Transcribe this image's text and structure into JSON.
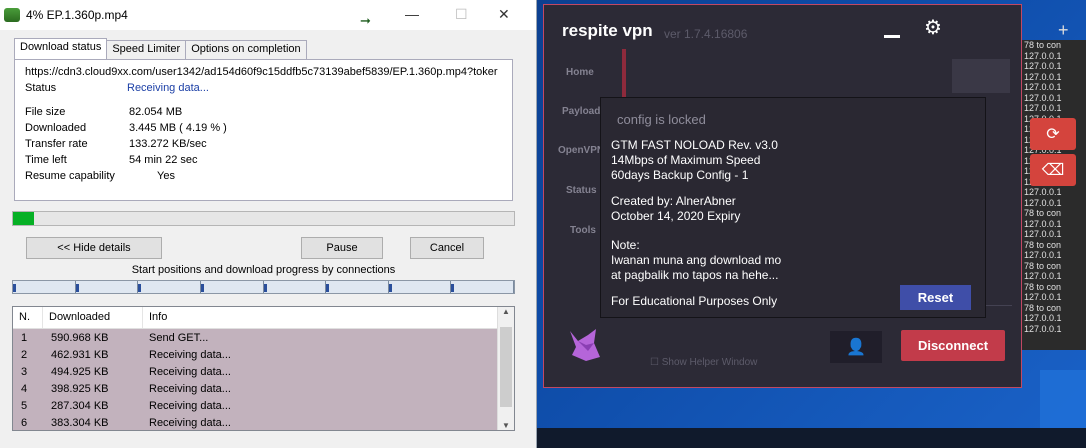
{
  "idm": {
    "title": "4% EP.1.360p.mp4",
    "tabs": [
      "Download status",
      "Speed Limiter",
      "Options on completion"
    ],
    "url": "https://cdn3.cloud9xx.com/user1342/ad154d60f9c15ddfb5c73139abef5839/EP.1.360p.mp4?toker",
    "status_label": "Status",
    "status_value": "Receiving data...",
    "file_size_label": "File size",
    "file_size_value": "82.054  MB",
    "downloaded_label": "Downloaded",
    "downloaded_value": "3.445  MB  ( 4.19 % )",
    "transfer_rate_label": "Transfer rate",
    "transfer_rate_value": "133.272  KB/sec",
    "time_left_label": "Time left",
    "time_left_value": "54 min 22 sec",
    "resume_label": "Resume capability",
    "resume_value": "Yes",
    "progress_fraction": 0.0419,
    "hide_details_label": "<< Hide details",
    "pause_label": "Pause",
    "cancel_label": "Cancel",
    "connections_caption": "Start positions and download progress by connections",
    "table_headers": [
      "N.",
      "Downloaded",
      "Info"
    ],
    "rows": [
      {
        "n": "1",
        "downloaded": "590.968  KB",
        "info": "Send GET..."
      },
      {
        "n": "2",
        "downloaded": "462.931  KB",
        "info": "Receiving data..."
      },
      {
        "n": "3",
        "downloaded": "494.925  KB",
        "info": "Receiving data..."
      },
      {
        "n": "4",
        "downloaded": "398.925  KB",
        "info": "Receiving data..."
      },
      {
        "n": "5",
        "downloaded": "287.304  KB",
        "info": "Receiving data..."
      },
      {
        "n": "6",
        "downloaded": "383.304  KB",
        "info": "Receiving data..."
      }
    ]
  },
  "vpn": {
    "title": "respite vpn",
    "version": "ver 1.7.4.16806",
    "sidebar": [
      "Home",
      "Payload",
      "OpenVPN",
      "Status",
      "Tools"
    ],
    "popup_locked": "config is locked",
    "popup_lines_1": "GTM FAST NOLOAD Rev. v3.0\n14Mbps of Maximum Speed\n60days Backup Config - 1",
    "popup_lines_2": "Created by: AlnerAbner\nOctober 14, 2020 Expiry",
    "popup_lines_3": "Note:\nIwanan muna ang download mo\nat pagbalik mo tapos na hehe...",
    "popup_lines_4": "For Educational Purposes Only",
    "reset_label": "Reset",
    "disconnect_label": "Disconnect",
    "helper_label": "Show Helper Window",
    "accent_color": "#c23b4a",
    "reset_color": "#3f4ea8"
  },
  "log": {
    "lines": [
      "78 to con",
      "127.0.0.1",
      "127.0.0.1",
      "127.0.0.1",
      "127.0.0.1",
      "127.0.0.1",
      "127.0.0.1",
      "127.0.0.1",
      "127.0.0.1",
      "127.0.0.1",
      "127.0.0.1",
      "127.0.0.1",
      "127.0.0.1",
      "127.0.0.1",
      "127.0.0.1",
      "127.0.0.1",
      "78 to con",
      "127.0.0.1",
      "127.0.0.1",
      "78 to con",
      "127.0.0.1",
      "78 to con",
      "127.0.0.1",
      "78 to con",
      "127.0.0.1",
      "78 to con",
      "127.0.0.1",
      "127.0.0.1"
    ]
  }
}
